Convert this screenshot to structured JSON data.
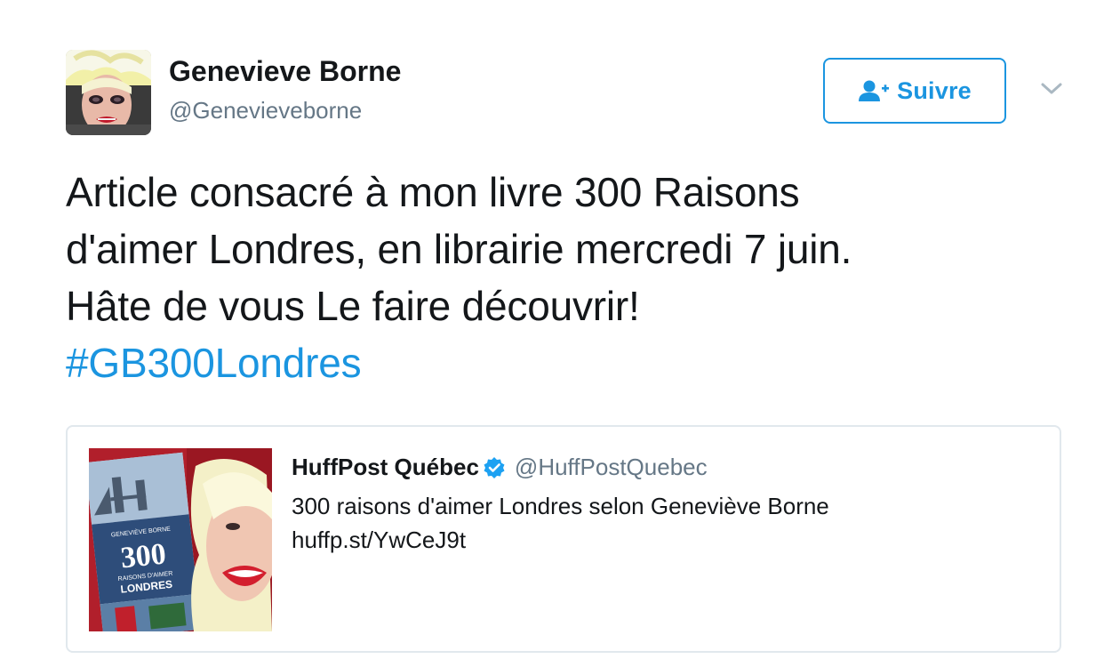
{
  "author": {
    "display_name": "Genevieve Borne",
    "handle": "@Genevieveborne"
  },
  "follow_button": {
    "label": "Suivre",
    "icon": "follow-user-plus-icon"
  },
  "more_menu": {
    "icon": "chevron-down-icon"
  },
  "tweet": {
    "lines": [
      "Article consacré à mon livre 300 Raisons",
      "d'aimer Londres, en librairie mercredi 7 juin.",
      "Hâte de vous Le faire découvrir!"
    ],
    "hashtag": "#GB300Londres"
  },
  "quote": {
    "name": "HuffPost Québec",
    "verified_icon": "verified-badge-icon",
    "handle": "@HuffPostQuebec",
    "text": "300 raisons d'aimer Londres selon Geneviève Borne",
    "link": "huffp.st/YwCeJ9t",
    "thumbnail": {
      "book_author": "GENEVIÈVE BORNE",
      "book_number": "300",
      "book_subtitle": "RAISONS D'AIMER",
      "book_title": "LONDRES"
    }
  },
  "colors": {
    "accent": "#1b95e0",
    "text": "#14171a",
    "secondary_text": "#657786",
    "border": "#e1e8ed"
  }
}
